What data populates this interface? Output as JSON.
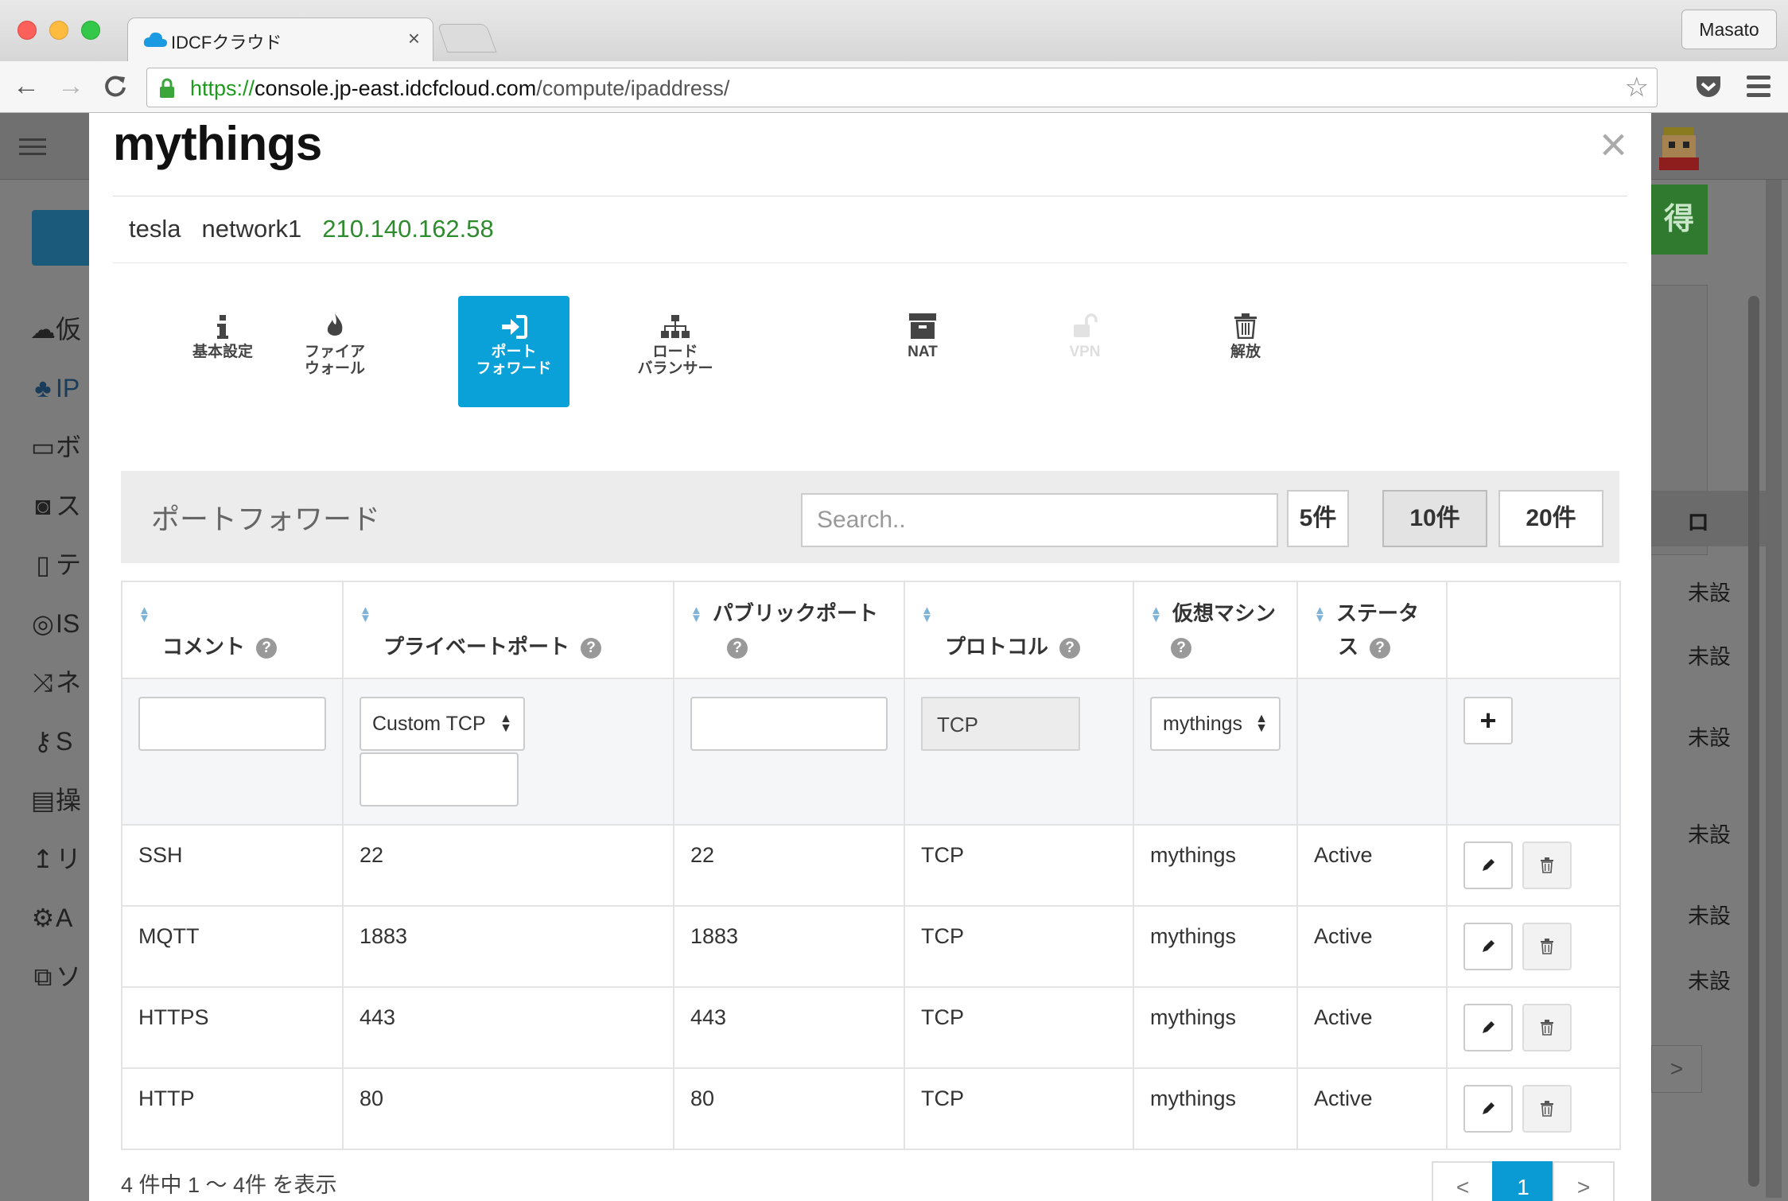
{
  "browser": {
    "tab_title": "IDCFクラウド",
    "tab_close": "×",
    "profile": "Masato",
    "url_scheme": "https://",
    "url_host": "console.jp-east.idcfcloud.com",
    "url_path": "/compute/ipaddress/",
    "back": "←",
    "forward": "→",
    "reload": "C",
    "star": "☆"
  },
  "background": {
    "nav_fragments": [
      "仮",
      "IP",
      "ボ",
      "ス",
      "テ",
      "IS",
      "ネ",
      "S",
      "操",
      "リ",
      "A",
      "ソ"
    ],
    "green_button": "得",
    "sort_header": "ロ",
    "cells": [
      "未設",
      "未設",
      "未設",
      "未設",
      "未設",
      "未設"
    ],
    "page_next": ">"
  },
  "modal": {
    "title": "mythings",
    "close": "×",
    "ip_info": {
      "vm": "tesla",
      "network": "network1",
      "ip": "210.140.162.58"
    },
    "feature_tabs": [
      {
        "line1": "基本設定",
        "line2": "",
        "icon": "info-icon",
        "active": false,
        "disabled": false
      },
      {
        "line1": "ファイア",
        "line2": "ウォール",
        "icon": "fire-icon",
        "active": false,
        "disabled": false
      },
      {
        "line1": "ポート",
        "line2": "フォワード",
        "icon": "sign-in-icon",
        "active": true,
        "disabled": false
      },
      {
        "line1": "ロード",
        "line2": "バランサー",
        "icon": "sitemap-icon",
        "active": false,
        "disabled": false
      },
      {
        "line1": "NAT",
        "line2": "",
        "icon": "archive-icon",
        "active": false,
        "disabled": false
      },
      {
        "line1": "VPN",
        "line2": "",
        "icon": "unlock-icon",
        "active": false,
        "disabled": true
      },
      {
        "line1": "解放",
        "line2": "",
        "icon": "trash-icon",
        "active": false,
        "disabled": false
      }
    ],
    "port_forward": {
      "title": "ポートフォワード",
      "search_placeholder": "Search..",
      "page_sizes": [
        "5件",
        "10件",
        "20件"
      ],
      "selected_page_size": "10件",
      "columns": [
        "コメント",
        "プライベートポート",
        "パブリックポート",
        "プロトコル",
        "仮想マシン",
        "ステータス"
      ],
      "column_status_line1": "ステータ",
      "column_status_line2": "ス",
      "help": "?",
      "new_row": {
        "private_port_type": "Custom TCP",
        "protocol": "TCP",
        "vm": "mythings",
        "add": "+"
      },
      "rows": [
        {
          "comment": "SSH",
          "private_port": "22",
          "public_port": "22",
          "protocol": "TCP",
          "vm": "mythings",
          "status": "Active"
        },
        {
          "comment": "MQTT",
          "private_port": "1883",
          "public_port": "1883",
          "protocol": "TCP",
          "vm": "mythings",
          "status": "Active"
        },
        {
          "comment": "HTTPS",
          "private_port": "443",
          "public_port": "443",
          "protocol": "TCP",
          "vm": "mythings",
          "status": "Active"
        },
        {
          "comment": "HTTP",
          "private_port": "80",
          "public_port": "80",
          "protocol": "TCP",
          "vm": "mythings",
          "status": "Active"
        }
      ],
      "summary": "4 件中 1 〜 4件 を表示",
      "pagination": {
        "prev": "<",
        "current": "1",
        "next": ">"
      }
    }
  },
  "colors": {
    "accent": "#0aa0d8",
    "active_status": "#3c9a3c",
    "ip": "#2e8b2e",
    "url_scheme": "#1e9a1e"
  }
}
